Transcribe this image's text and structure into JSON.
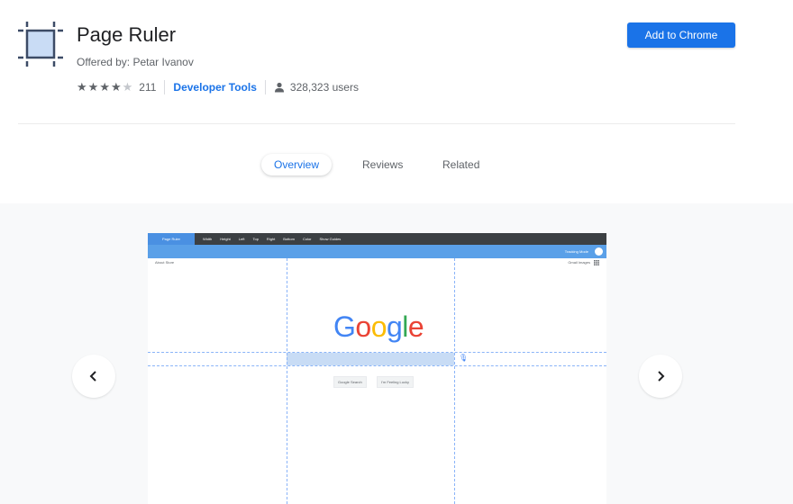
{
  "extension": {
    "title": "Page Ruler",
    "offered_by": "Offered by: Petar Ivanov",
    "rating": 4,
    "rating_count": "211",
    "category": "Developer Tools",
    "users": "328,323 users",
    "add_button": "Add to Chrome"
  },
  "tabs": [
    {
      "label": "Overview",
      "active": true
    },
    {
      "label": "Reviews",
      "active": false
    },
    {
      "label": "Related",
      "active": false
    }
  ],
  "colors": {
    "accent": "#1a73e8",
    "gallery_bg": "#f8f9fa",
    "toolbar_dark": "#3c4043",
    "toolbar_blue": "#5aa0e8"
  },
  "screenshot": {
    "toolbar_top": {
      "brand": "Page Ruler",
      "items": [
        "Width",
        "Height",
        "Left",
        "Top",
        "Right",
        "Bottom",
        "Color",
        "Show Guides"
      ]
    },
    "google_nav_left": "About   Store",
    "google_nav_right": "Gmail   Images",
    "google_logo": "Google",
    "buttons": [
      "Google Search",
      "I'm Feeling Lucky"
    ],
    "tracking_mode": "Tracking Mode"
  },
  "icons": {
    "prev": "chevron-left-icon",
    "next": "chevron-right-icon",
    "user": "person-icon",
    "logo": "ruler-square-icon"
  }
}
